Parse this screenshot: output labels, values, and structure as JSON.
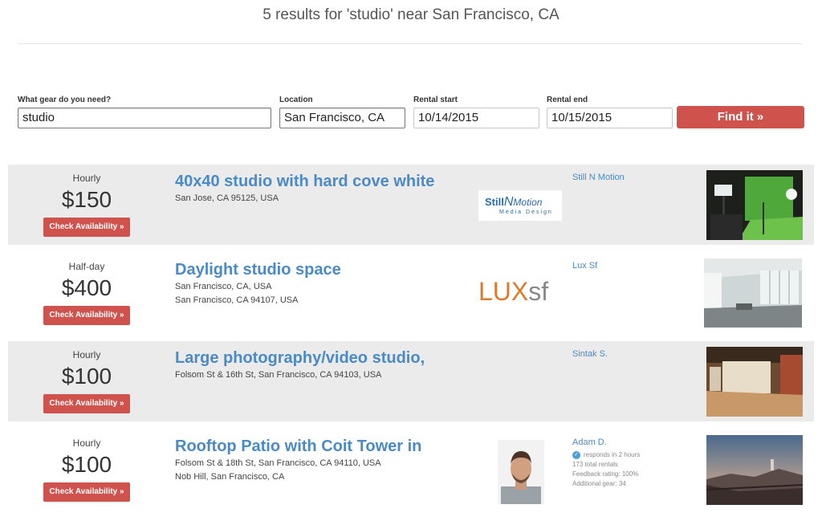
{
  "header": {
    "title": "5 results for 'studio' near San Francisco, CA"
  },
  "search": {
    "gear_label": "What gear do you need?",
    "gear_value": "studio",
    "location_label": "Location",
    "location_value": "San Francisco, CA",
    "start_label": "Rental start",
    "start_value": "10/14/2015",
    "end_label": "Rental end",
    "end_value": "10/15/2015",
    "submit_label": "Find it »"
  },
  "results": [
    {
      "price_unit": "Hourly",
      "price": "$150",
      "button_label": "Check Availability »",
      "title": "40x40 studio with hard cove white",
      "address_lines": [
        "San Jose, CA 95125, USA"
      ],
      "logo_text_1": "Still",
      "logo_text_2": "N",
      "logo_text_3": "Motion",
      "logo_subtext": "Media Design",
      "owner_name": "Still N Motion"
    },
    {
      "price_unit": "Half-day",
      "price": "$400",
      "button_label": "Check Availability »",
      "title": "Daylight studio space",
      "address_lines": [
        "San Francisco, CA, USA",
        "San Francisco, CA 94107, USA"
      ],
      "logo_text_1": "LUX",
      "logo_text_2": "sf",
      "owner_name": "Lux Sf"
    },
    {
      "price_unit": "Hourly",
      "price": "$100",
      "button_label": "Check Availability »",
      "title": "Large photography/video studio,",
      "address_lines": [
        "Folsom St & 16th St, San Francisco, CA 94103, USA"
      ],
      "owner_name": "Sintak S."
    },
    {
      "price_unit": "Hourly",
      "price": "$100",
      "button_label": "Check Availability »",
      "title": "Rooftop Patio with Coit Tower in",
      "address_lines": [
        "Folsom St & 18th St, San Francisco, CA 94110, USA",
        "Nob Hill, San Francisco, CA"
      ],
      "owner_name": "Adam D.",
      "owner_response": "responds in 2 hours",
      "owner_rentals": "173 total rentals",
      "owner_feedback": "Feedback rating: 100%",
      "owner_gear": "Additional gear: 34"
    }
  ],
  "colors": {
    "accent_red": "#d0524d",
    "link_blue": "#4a8ac8",
    "row_shade": "#ebebeb"
  },
  "icons": {
    "verified": "check-circle-icon"
  }
}
